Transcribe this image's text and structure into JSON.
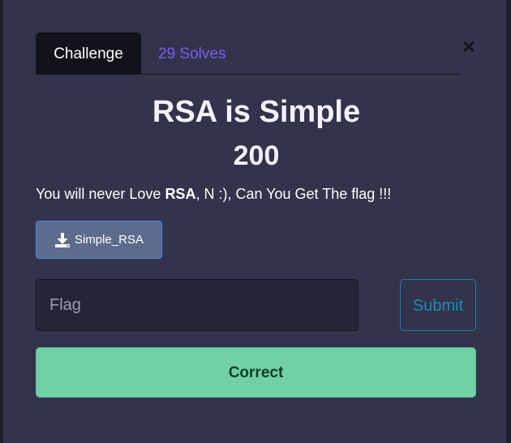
{
  "tabs": {
    "challenge_label": "Challenge",
    "solves_label": "29 Solves"
  },
  "close_glyph": "×",
  "challenge": {
    "name": "RSA is Simple",
    "value": "200",
    "description": {
      "part1": "You will never Love ",
      "bold": "RSA",
      "part2": ", N :), Can You Get The flag !!!"
    },
    "file_label": "Simple_RSA",
    "file_icon": "download-icon"
  },
  "form": {
    "flag_placeholder": "Flag",
    "flag_value": "",
    "submit_label": "Submit"
  },
  "result": {
    "message": "Correct"
  },
  "colors": {
    "modal_bg": "#33334b",
    "accent_purple": "#7a5cf0",
    "success_green": "#72d0a5",
    "file_button": "#5d6c8c",
    "submit_outline": "#1a7fa0"
  }
}
